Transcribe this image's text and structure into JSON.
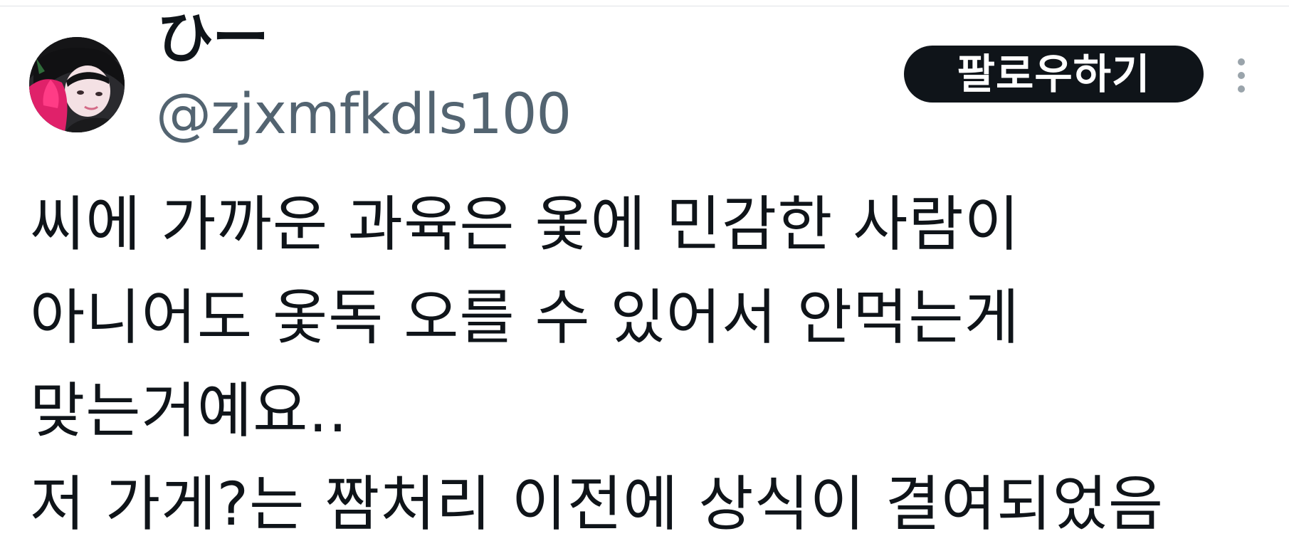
{
  "author": {
    "display_name": "ひー",
    "handle": "@zjxmfkdls100",
    "avatar_icon": "user-avatar-photo"
  },
  "actions": {
    "follow_label": "팔로우하기",
    "more_icon": "more-vertical-icon"
  },
  "tweet": {
    "lines": [
      "씨에 가까운 과육은 옻에 민감한 사람이",
      "아니어도 옻독 오를 수 있어서 안먹는게",
      "맞는거예요..",
      "저 가게?는 짬처리 이전에 상식이 결여되었음"
    ]
  },
  "colors": {
    "text_primary": "#0f1419",
    "text_secondary": "#536471",
    "button_bg": "#0f1419",
    "button_text": "#ffffff",
    "divider": "#dfe3e6"
  }
}
